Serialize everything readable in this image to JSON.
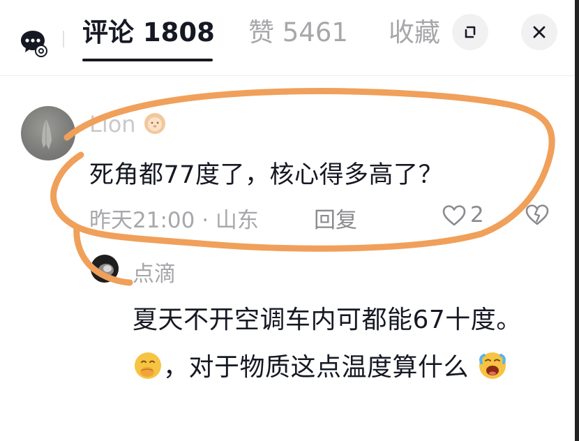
{
  "header": {
    "tabs": [
      {
        "label": "评论 1808"
      },
      {
        "label": "赞 5461"
      },
      {
        "label": "收藏"
      }
    ],
    "icons": {
      "left": "bot-settings-icon",
      "expand": "expand-icon",
      "close": "close-icon"
    }
  },
  "comments": [
    {
      "user": "Lion",
      "user_emoji": "lion-face-emoji",
      "text": "死角都77度了，核心得多高了？",
      "time": "昨天21:00",
      "location": "山东",
      "meta": "昨天21:00 · 山东",
      "reply_label": "回复",
      "likes": "2"
    }
  ],
  "replies": [
    {
      "user": "点滴",
      "text_1": "夏天不开空调车内可都能67十度。",
      "text_2": "，对于物质这点温度算什么",
      "emojis": [
        "face-with-hand-over-mouth-emoji",
        "face-screaming-emoji"
      ]
    }
  ],
  "colors": {
    "annotation": "#f0a05a",
    "text_primary": "#161823",
    "text_secondary": "#a7a7ab"
  }
}
